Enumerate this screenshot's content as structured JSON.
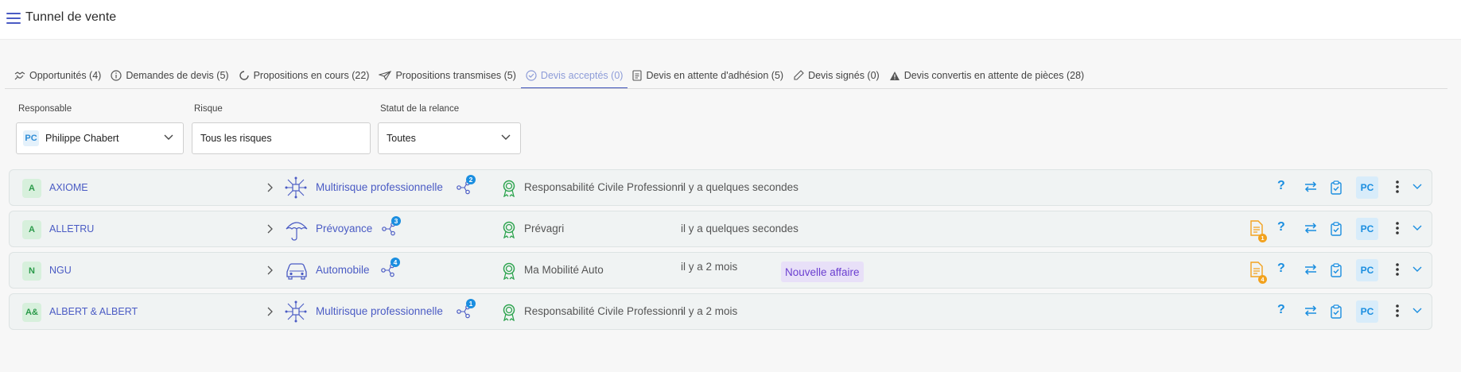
{
  "header": {
    "title": "Tunnel de vente"
  },
  "tabs": [
    {
      "label": "Opportunités (4)",
      "icon": "handshake-icon"
    },
    {
      "label": "Demandes de devis (5)",
      "icon": "info-icon"
    },
    {
      "label": "Propositions en cours (22)",
      "icon": "spinner-icon"
    },
    {
      "label": "Propositions transmises (5)",
      "icon": "paper-plane-icon"
    },
    {
      "label": "Devis acceptés (0)",
      "icon": "check-circle-icon",
      "active": true
    },
    {
      "label": "Devis en attente d'adhésion (5)",
      "icon": "document-icon"
    },
    {
      "label": "Devis signés (0)",
      "icon": "pen-icon"
    },
    {
      "label": "Devis convertis en attente de pièces (28)",
      "icon": "warning-icon"
    }
  ],
  "filters": {
    "responsable": {
      "label": "Responsable",
      "value": "Philippe Chabert",
      "initials": "PC"
    },
    "risque": {
      "label": "Risque",
      "value": "Tous les risques"
    },
    "statut": {
      "label": "Statut de la relance",
      "value": "Toutes"
    }
  },
  "rows": [
    {
      "avatar": "A",
      "company": "AXIOME",
      "product": "Multirisque professionnelle",
      "product_icon": "network-icon",
      "share_count": "2",
      "contract": "Responsabilité Civile Professionnelle",
      "time": "il y a quelques secondes",
      "badge": "",
      "doc_count": "",
      "owner": "PC"
    },
    {
      "avatar": "A",
      "company": "ALLETRU",
      "product": "Prévoyance",
      "product_icon": "umbrella-icon",
      "share_count": "3",
      "contract": "Prévagri",
      "time": "il y a quelques secondes",
      "badge": "",
      "doc_count": "1",
      "owner": "PC"
    },
    {
      "avatar": "N",
      "company": "NGU",
      "product": "Automobile",
      "product_icon": "car-icon",
      "share_count": "4",
      "contract": "Ma Mobilité Auto",
      "time": "il y a 2 mois",
      "badge": "Nouvelle affaire",
      "doc_count": "4",
      "owner": "PC"
    },
    {
      "avatar": "A&",
      "company": "ALBERT & ALBERT",
      "product": "Multirisque professionnelle",
      "product_icon": "network-icon",
      "share_count": "1",
      "contract": "Responsabilité Civile Professionnelle",
      "time": "il y a 2 mois",
      "badge": "",
      "doc_count": "",
      "owner": "PC"
    }
  ],
  "colors": {
    "accent": "#4a5bc4",
    "action_blue": "#1a8ee0",
    "badge_purple": "#6b3fd0",
    "badge_bg": "#e8e0f8",
    "doc_orange": "#f2a21e"
  }
}
